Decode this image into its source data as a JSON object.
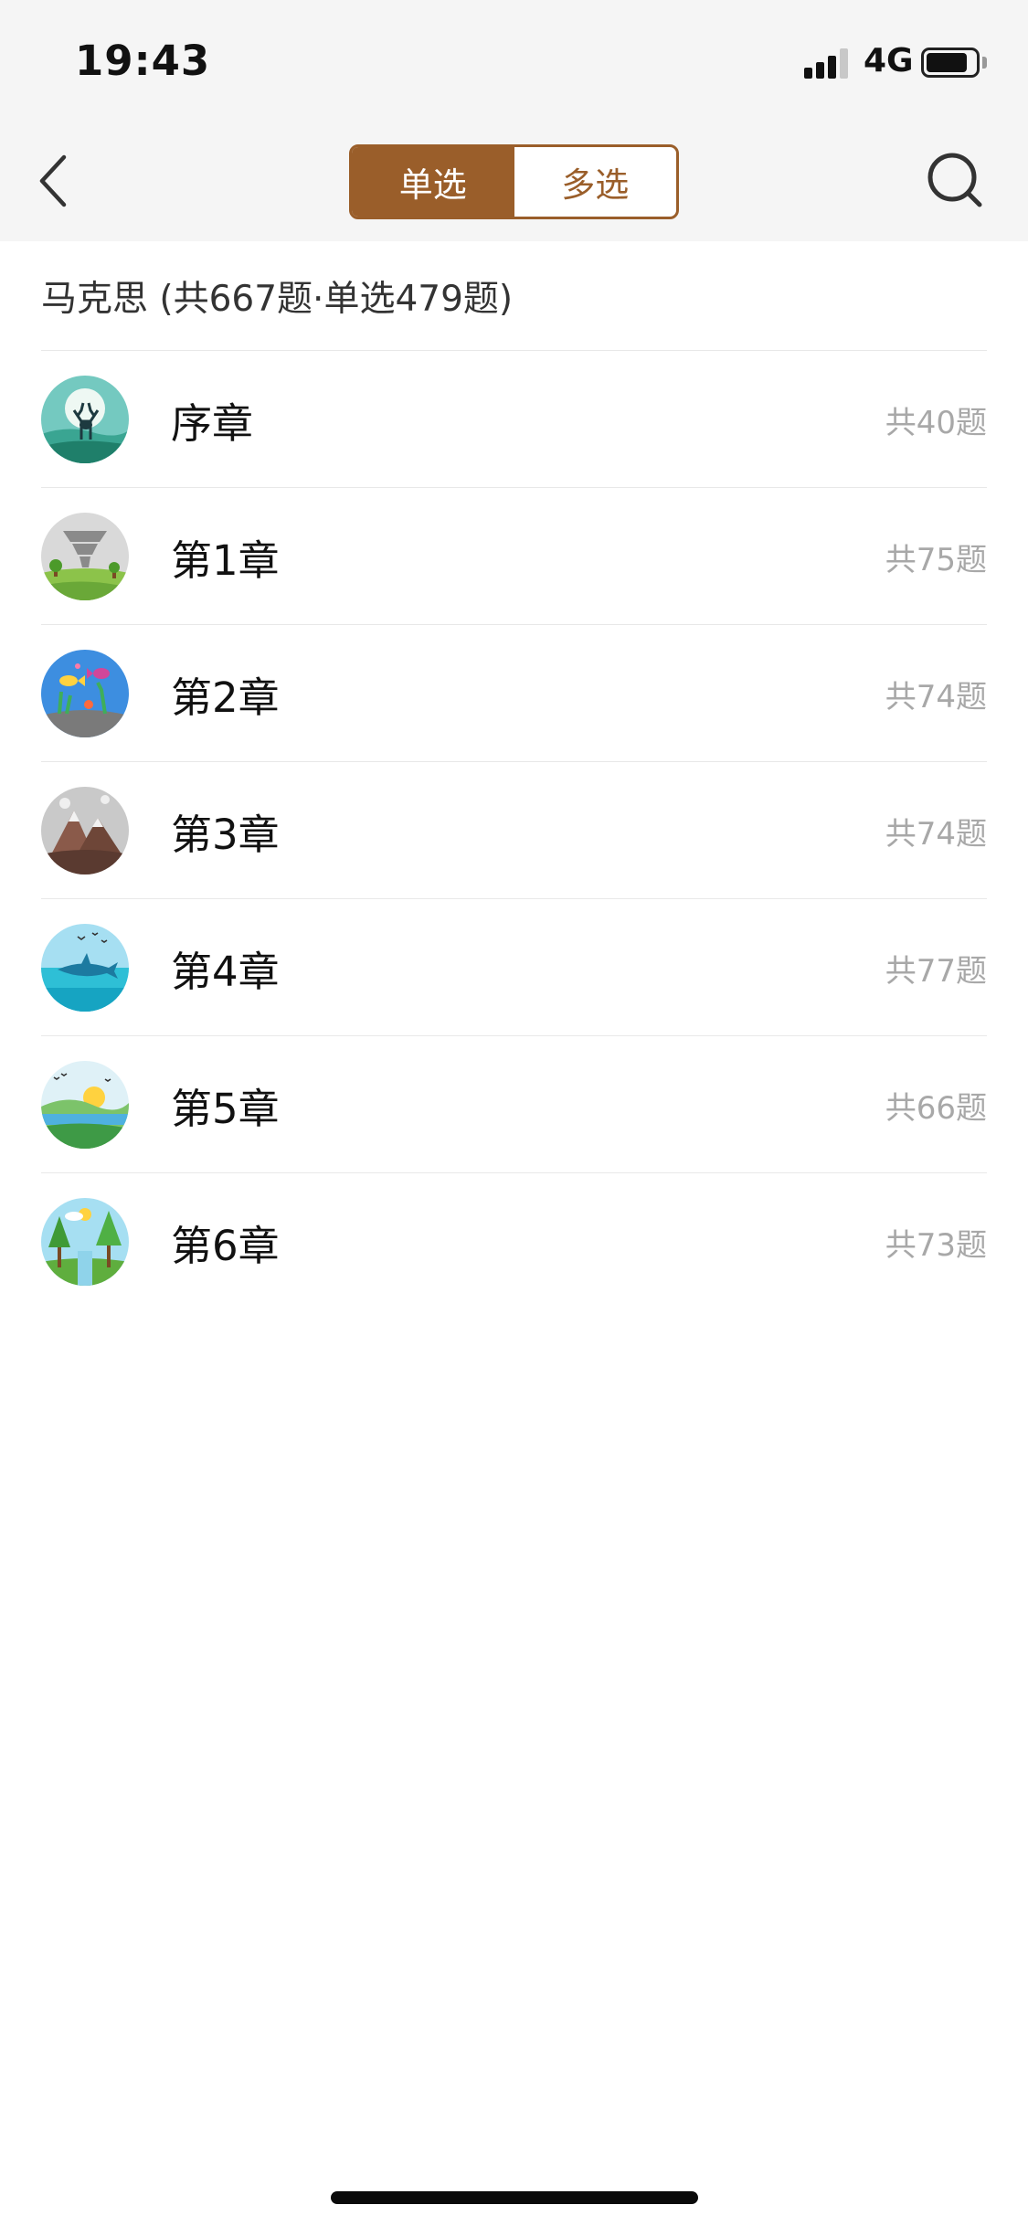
{
  "status_bar": {
    "time": "19:43",
    "network": "4G",
    "battery_level": 0.85
  },
  "nav": {
    "tabs": [
      {
        "label": "单选",
        "active": true
      },
      {
        "label": "多选",
        "active": false
      }
    ]
  },
  "subject": {
    "header": "马克思 (共667题·单选479题)"
  },
  "chapters": [
    {
      "title": "序章",
      "count": "共40题",
      "icon": "deer-moon-icon"
    },
    {
      "title": "第1章",
      "count": "共75题",
      "icon": "tornado-icon"
    },
    {
      "title": "第2章",
      "count": "共74题",
      "icon": "sea-fish-icon"
    },
    {
      "title": "第3章",
      "count": "共74题",
      "icon": "mountain-icon"
    },
    {
      "title": "第4章",
      "count": "共77题",
      "icon": "shark-icon"
    },
    {
      "title": "第5章",
      "count": "共66题",
      "icon": "sunset-lake-icon"
    },
    {
      "title": "第6章",
      "count": "共73题",
      "icon": "forest-icon"
    }
  ],
  "colors": {
    "accent": "#9a5e2a",
    "count_text": "#a8a8a8"
  }
}
